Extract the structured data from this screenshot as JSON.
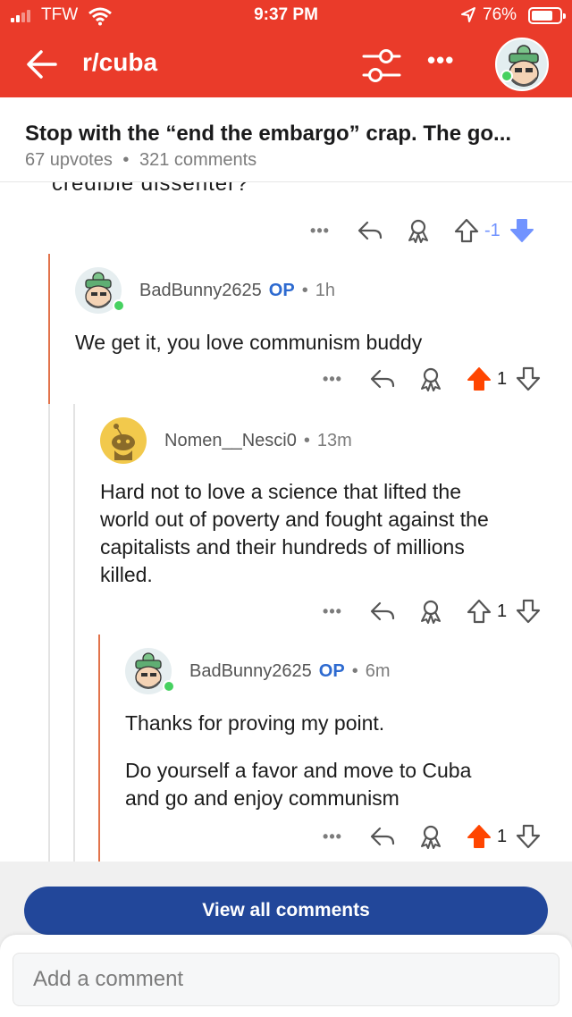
{
  "status_bar": {
    "carrier": "TFW",
    "time": "9:37 PM",
    "battery": "76%",
    "battery_level": 0.76
  },
  "nav": {
    "subreddit": "r/cuba",
    "back_icon": "arrow-left-icon",
    "filter_icon": "sliders-icon",
    "more_icon": "more-horizontal-icon"
  },
  "post": {
    "title": "Stop with the “end the embargo” crap. The go...",
    "upvotes": "67 upvotes",
    "separator": "•",
    "comments": "321 comments"
  },
  "cut_off_text": "credible dissenter?",
  "comments": [
    {
      "actions": {
        "more": "•••",
        "vote_count": "-1",
        "vote_state": "downvoted",
        "vote_color": "#7193ff"
      }
    },
    {
      "author": "BadBunny2625",
      "op_label": "OP",
      "sep": "•",
      "time": "1h",
      "body": "We get it, you love communism buddy",
      "actions": {
        "more": "•••",
        "vote_count": "1",
        "vote_state": "upvoted",
        "vote_color": "#ff4500"
      }
    },
    {
      "author": "Nomen__Nesci0",
      "sep": "•",
      "time": "13m",
      "body_lines": [
        "Hard not to love a science that lifted the",
        "world out of poverty and fought against the",
        "capitalists and their hundreds of millions",
        "killed."
      ],
      "actions": {
        "more": "•••",
        "vote_count": "1",
        "vote_state": "none"
      }
    },
    {
      "author": "BadBunny2625",
      "op_label": "OP",
      "sep": "•",
      "time": "6m",
      "body_p1": "Thanks for proving my point.",
      "body_p2_lines": [
        "Do yourself a favor and move to Cuba",
        "and go and enjoy communism"
      ],
      "actions": {
        "more": "•••",
        "vote_count": "1",
        "vote_state": "upvoted",
        "vote_color": "#ff4500"
      }
    }
  ],
  "bottom": {
    "view_all": "View all comments",
    "add_comment_placeholder": "Add a comment"
  },
  "colors": {
    "header": "#ea3b2a",
    "upvote": "#ff4500",
    "downvote": "#7193ff",
    "op": "#2d6ad0",
    "button": "#22479a",
    "thread_line": "#e2734b"
  }
}
